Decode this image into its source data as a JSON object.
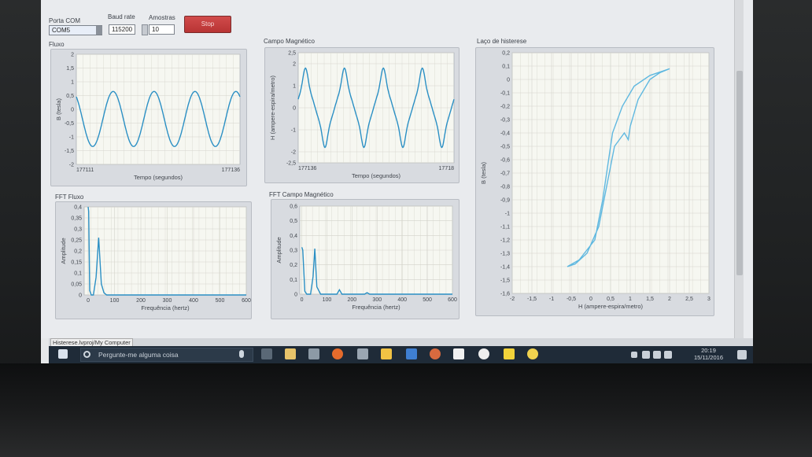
{
  "controls": {
    "porta_com_label": "Porta COM",
    "porta_com_value": "COM5",
    "baud_label": "Baud rate",
    "baud_value": "115200",
    "amostras_label": "Amostras",
    "amostras_value": "10",
    "stop_label": "Stop"
  },
  "panels": {
    "fluxo": {
      "title": "Fluxo"
    },
    "campo": {
      "title": "Campo Magnético"
    },
    "fft_fluxo": {
      "title": "FFT Fluxo"
    },
    "fft_campo": {
      "title": "FFT Campo Magnético"
    },
    "laco": {
      "title": "Laço de histerese"
    }
  },
  "chart_data": [
    {
      "type": "line",
      "title": "Fluxo",
      "xlabel": "Tempo (segundos)",
      "ylabel": "B (tesla)",
      "xlim_labels": [
        "177111",
        "177136"
      ],
      "yticks": [
        2,
        1.5,
        1,
        0.5,
        0,
        -0.5,
        -1,
        -1.5,
        -2
      ],
      "ylim": [
        -2,
        2
      ],
      "series": [
        {
          "shape": "sine",
          "cycles": 4,
          "amplitude": 1.0,
          "offset": -0.35,
          "color": "#2a8fc4"
        }
      ]
    },
    {
      "type": "line",
      "title": "Campo Magnético",
      "xlabel": "Tempo (segundos)",
      "ylabel": "H (ampere-espira/metro)",
      "xlim_labels": [
        "177136",
        "17718"
      ],
      "yticks": [
        2.5,
        2,
        1,
        0,
        -1,
        -2,
        -2.5
      ],
      "ylim": [
        -2.5,
        2.5
      ],
      "series": [
        {
          "shape": "peaked",
          "cycles": 4,
          "amplitude": 1.8,
          "color": "#2a8fc4"
        }
      ]
    },
    {
      "type": "line",
      "title": "FFT Fluxo",
      "xlabel": "Frequência (hertz)",
      "ylabel": "Amplitude",
      "xticks": [
        0,
        100,
        200,
        300,
        400,
        500,
        600
      ],
      "yticks": [
        0.4,
        0.35,
        0.3,
        0.25,
        0.2,
        0.15,
        0.1,
        0.05,
        0
      ],
      "xlim": [
        -15,
        600
      ],
      "ylim": [
        0,
        0.4
      ],
      "series": [
        {
          "x": [
            0,
            2,
            6,
            12,
            20,
            30,
            40,
            50,
            60,
            70,
            90,
            600
          ],
          "y": [
            0.4,
            0.38,
            0.02,
            0,
            0,
            0.08,
            0.26,
            0.05,
            0.01,
            0,
            0,
            0
          ],
          "color": "#2a8fc4"
        }
      ]
    },
    {
      "type": "line",
      "title": "FFT Campo Magnético",
      "xlabel": "Frequência (hertz)",
      "ylabel": "Amplitude",
      "xticks": [
        0,
        100,
        200,
        300,
        400,
        500,
        600
      ],
      "yticks": [
        0.6,
        0.5,
        0.4,
        0.3,
        0.2,
        0.1,
        0
      ],
      "xlim": [
        -8,
        600
      ],
      "ylim": [
        0,
        0.6
      ],
      "series": [
        {
          "x": [
            0,
            4,
            12,
            20,
            35,
            45,
            52,
            60,
            75,
            100,
            140,
            150,
            160,
            180,
            250,
            260,
            270,
            600
          ],
          "y": [
            0.32,
            0.3,
            0.02,
            0,
            0,
            0.12,
            0.31,
            0.05,
            0,
            0,
            0,
            0.03,
            0,
            0,
            0,
            0.01,
            0,
            0
          ],
          "color": "#2a8fc4"
        }
      ]
    },
    {
      "type": "scatter",
      "title": "Laço de histerese",
      "xlabel": "H (ampere-espira/metro)",
      "ylabel": "B (tesla)",
      "xticks": [
        -2,
        -1.5,
        -1,
        -0.5,
        0,
        0.5,
        1,
        1.5,
        2,
        2.5,
        3
      ],
      "yticks": [
        0.2,
        0.1,
        0,
        -0.1,
        -0.2,
        -0.3,
        -0.4,
        -0.5,
        -0.6,
        -0.7,
        -0.8,
        -0.9,
        -1,
        -1.1,
        -1.2,
        -1.3,
        -1.4,
        -1.5,
        -1.6
      ],
      "xlim": [
        -2,
        3
      ],
      "ylim": [
        -1.6,
        0.2
      ],
      "series": [
        {
          "x": [
            -0.6,
            -0.3,
            0.1,
            0.3,
            0.45,
            0.55,
            0.8,
            1.1,
            1.5,
            2.0,
            1.75,
            1.5,
            1.2,
            1.0,
            0.95,
            0.85,
            0.6,
            0.4,
            0.2,
            -0.1,
            -0.4,
            -0.6
          ],
          "y": [
            -1.4,
            -1.35,
            -1.2,
            -0.9,
            -0.6,
            -0.4,
            -0.2,
            -0.05,
            0.03,
            0.08,
            0.05,
            0.0,
            -0.15,
            -0.35,
            -0.45,
            -0.4,
            -0.5,
            -0.8,
            -1.1,
            -1.3,
            -1.38,
            -1.4
          ],
          "color": "#5fb8e0"
        }
      ]
    }
  ],
  "status": {
    "text": "Histerese.lvproj/My Computer"
  },
  "taskbar": {
    "search_placeholder": "Pergunte-me alguma coisa",
    "time": "20:19",
    "date": "15/11/2016"
  }
}
